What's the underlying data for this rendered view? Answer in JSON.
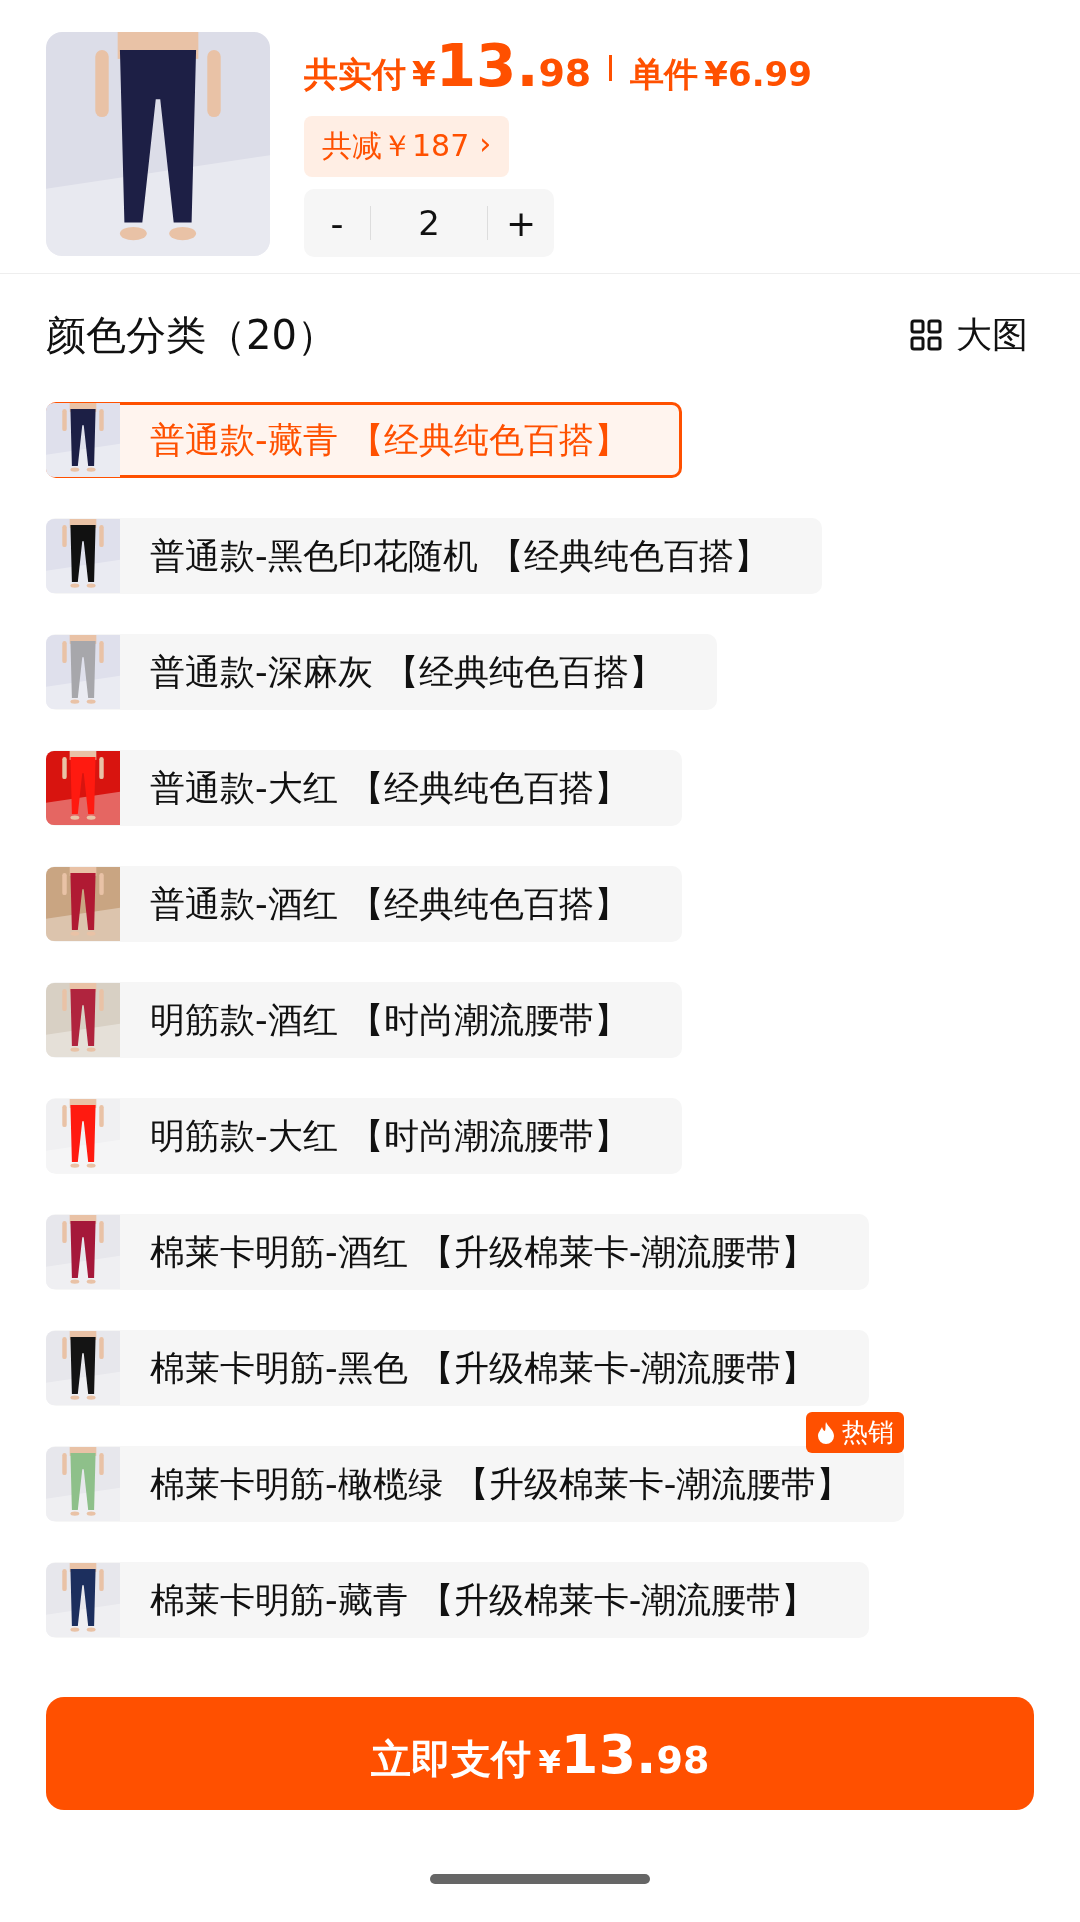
{
  "product": {
    "total_label": "共实付",
    "total_currency": "¥",
    "total_int": "13.",
    "total_dec": "98",
    "unit_label": "单件",
    "unit_price": "¥6.99",
    "discount": "共减￥187",
    "discount_arrow": "›",
    "quantity": {
      "minus": "-",
      "value": "2",
      "plus": "+"
    }
  },
  "section": {
    "title": "颜色分类（20）",
    "view_label": "大图"
  },
  "options": [
    {
      "label": "普通款-藏青 【经典纯色百搭】",
      "selected": true
    },
    {
      "label": "普通款-黑色印花随机 【经典纯色百搭】",
      "selected": false
    },
    {
      "label": "普通款-深麻灰 【经典纯色百搭】",
      "selected": false
    },
    {
      "label": "普通款-大红 【经典纯色百搭】",
      "selected": false
    },
    {
      "label": "普通款-酒红 【经典纯色百搭】",
      "selected": false
    },
    {
      "label": "明筋款-酒红 【时尚潮流腰带】",
      "selected": false
    },
    {
      "label": "明筋款-大红 【时尚潮流腰带】",
      "selected": false
    },
    {
      "label": "棉莱卡明筋-酒红 【升级棉莱卡-潮流腰带】",
      "selected": false
    },
    {
      "label": "棉莱卡明筋-黑色 【升级棉莱卡-潮流腰带】",
      "selected": false
    },
    {
      "label": "棉莱卡明筋-橄榄绿 【升级棉莱卡-潮流腰带】",
      "selected": false,
      "badge": "热销"
    },
    {
      "label": "棉莱卡明筋-藏青 【升级棉莱卡-潮流腰带】",
      "selected": false
    }
  ],
  "pay_button": {
    "label": "立即支付",
    "currency": "¥",
    "int": "13.",
    "dec": "98"
  }
}
